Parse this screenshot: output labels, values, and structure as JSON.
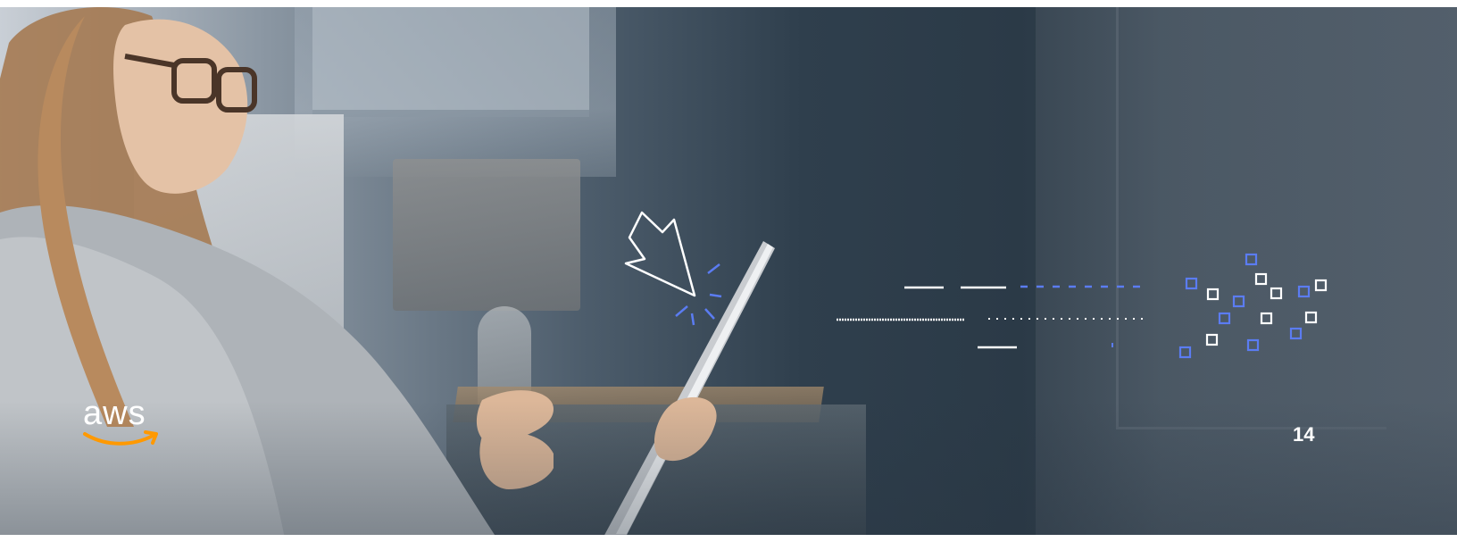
{
  "slide": {
    "page_number": "14",
    "brand": {
      "logo_text": "aws",
      "smile_color": "#FF9900"
    },
    "graphic": {
      "icon": "cursor-click-icon",
      "accent_color": "#5B7CF2",
      "line_color": "#FFFFFF",
      "motif": "data-stream-to-pixels"
    }
  }
}
